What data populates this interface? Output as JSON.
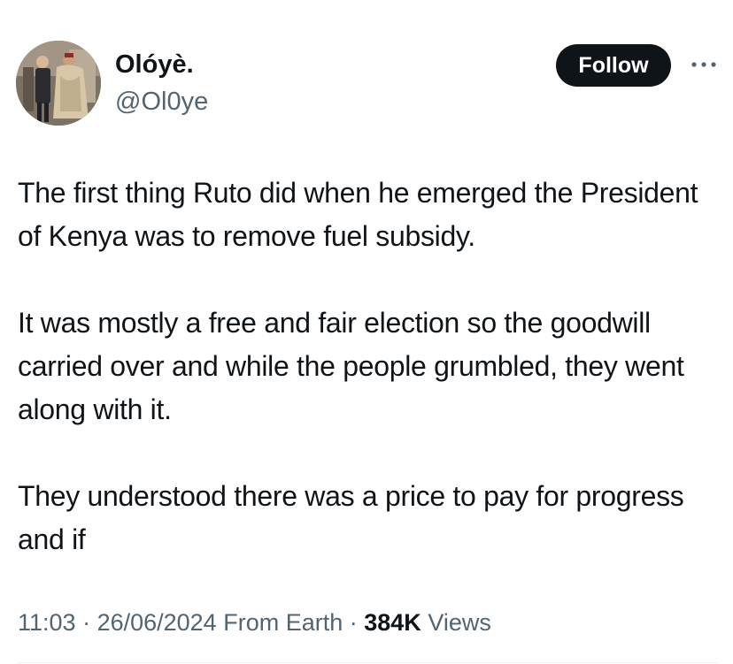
{
  "author": {
    "display_name": "Olóyè.",
    "handle": "@Ol0ye",
    "avatar_icon": "profile-photo"
  },
  "actions": {
    "follow_label": "Follow",
    "more_icon": "more-horizontal-icon"
  },
  "tweet": {
    "paragraphs": [
      "The first thing Ruto did when he emerged the President of Kenya was to remove fuel subsidy.",
      "It was mostly a free and fair election so the goodwill carried over and while the people grumbled, they went along with it.",
      "They understood there was a price to pay for progress and if"
    ]
  },
  "meta": {
    "time": "11:03",
    "separator": " · ",
    "date": "26/06/2024",
    "source": "From Earth",
    "views_count": "384K",
    "views_label": "Views"
  },
  "colors": {
    "text_primary": "#0f1419",
    "text_secondary": "#536471",
    "follow_bg": "#0f1419",
    "follow_text": "#ffffff"
  }
}
